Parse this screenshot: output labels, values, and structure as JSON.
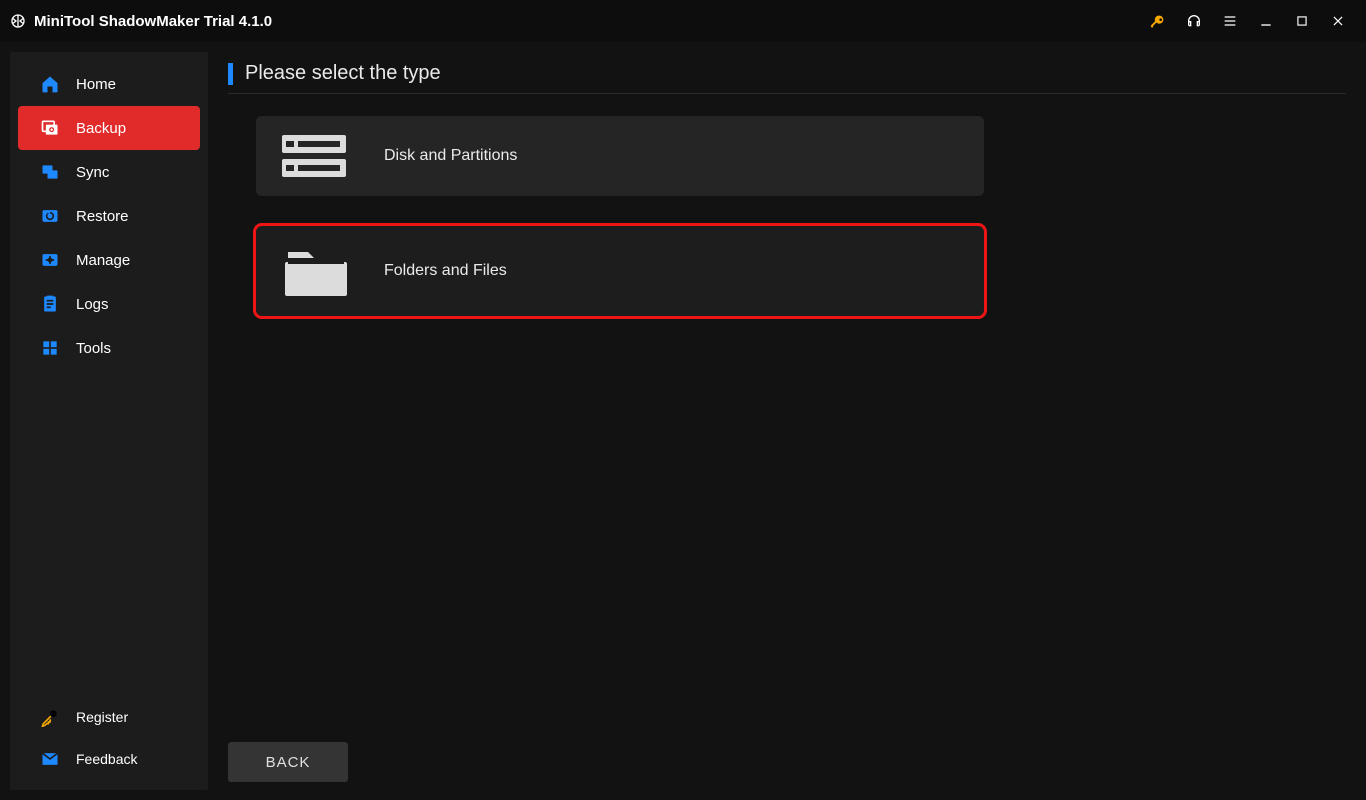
{
  "app": {
    "title": "MiniTool ShadowMaker Trial 4.1.0"
  },
  "titlebar": {
    "icons": {
      "register": "register-key-icon",
      "help": "headset-icon",
      "menu": "menu-icon",
      "minimize": "minimize-icon",
      "maximize": "maximize-icon",
      "close": "close-icon"
    }
  },
  "sidebar": {
    "items": [
      {
        "icon": "home-icon",
        "label": "Home"
      },
      {
        "icon": "backup-icon",
        "label": "Backup",
        "active": true
      },
      {
        "icon": "sync-icon",
        "label": "Sync"
      },
      {
        "icon": "restore-icon",
        "label": "Restore"
      },
      {
        "icon": "manage-icon",
        "label": "Manage"
      },
      {
        "icon": "logs-icon",
        "label": "Logs"
      },
      {
        "icon": "tools-icon",
        "label": "Tools"
      }
    ],
    "bottom": [
      {
        "icon": "register-icon",
        "label": "Register"
      },
      {
        "icon": "feedback-icon",
        "label": "Feedback"
      }
    ]
  },
  "main": {
    "heading": "Please select the type",
    "options": [
      {
        "icon": "disk-partitions-icon",
        "label": "Disk and Partitions",
        "highlight": false
      },
      {
        "icon": "folder-icon",
        "label": "Folders and Files",
        "highlight": true
      }
    ],
    "back_label": "BACK"
  }
}
